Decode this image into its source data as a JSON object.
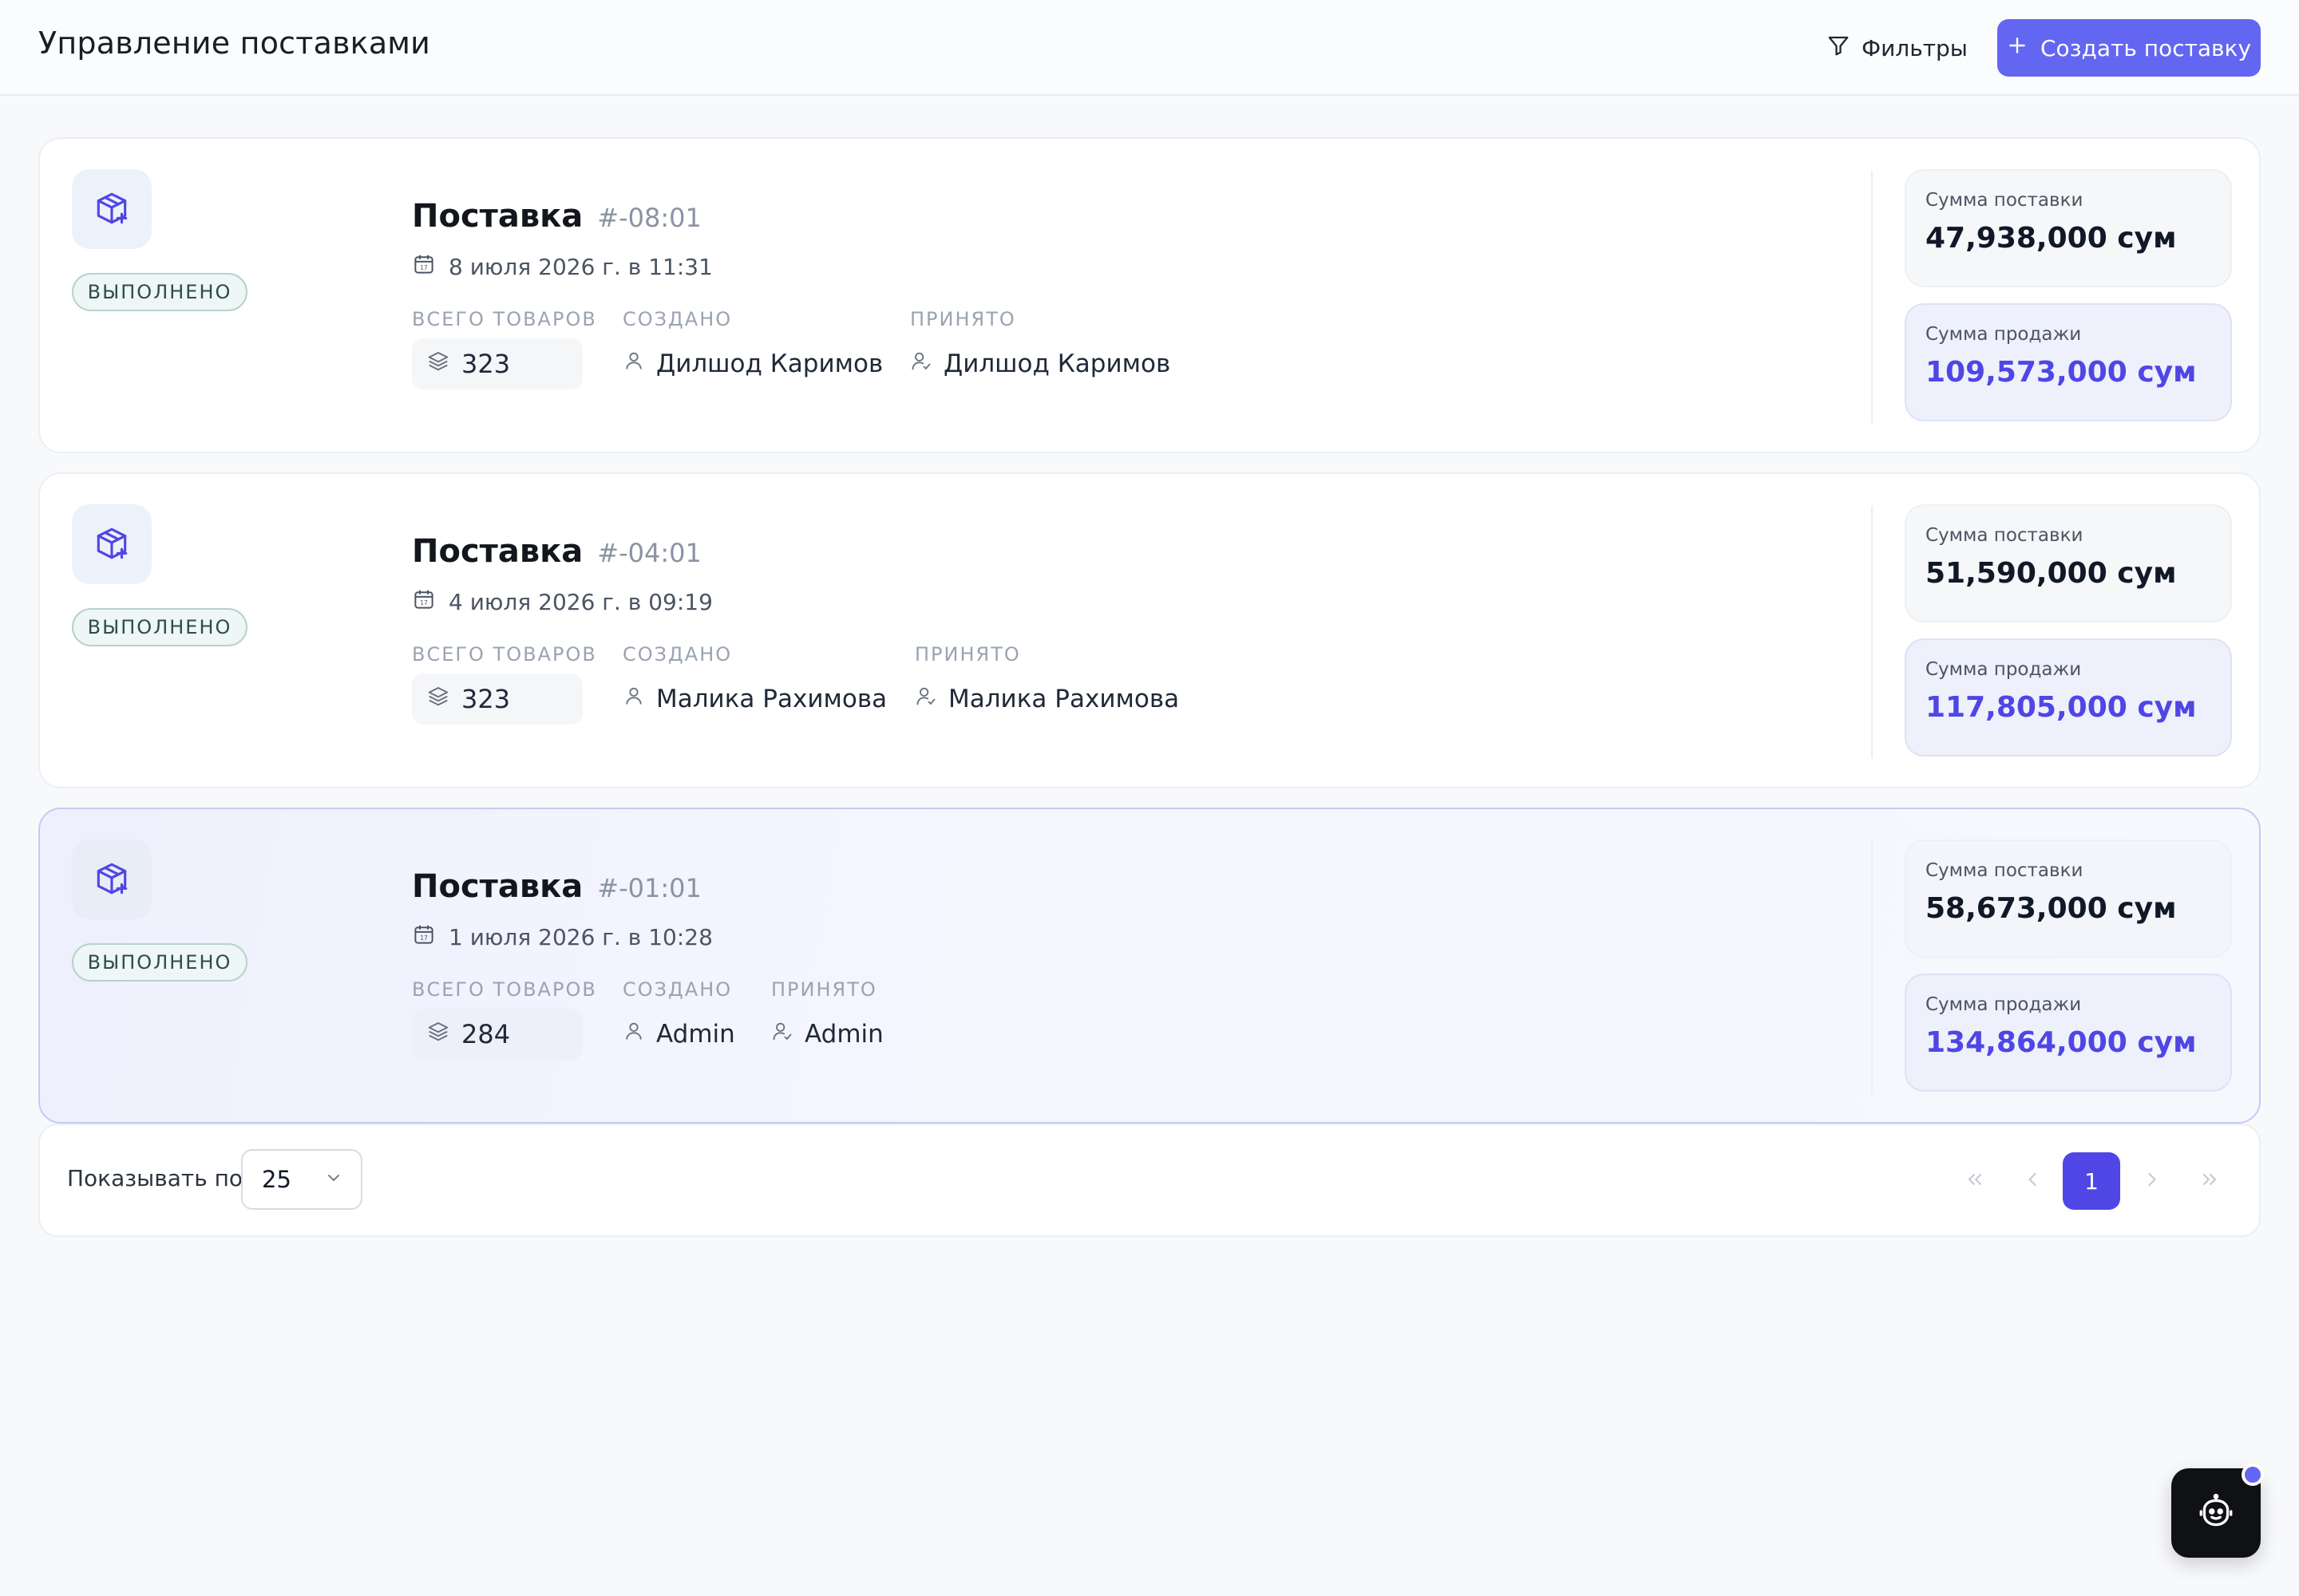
{
  "header": {
    "title": "Управление поставками",
    "filters_label": "Фильтры",
    "create_label": "Создать поставку",
    "filter_icon": "filter-icon",
    "plus_icon": "plus-icon"
  },
  "meta_labels": {
    "total_items": "ВСЕГО ТОВАРОВ",
    "created": "СОЗДАНО",
    "accepted": "ПРИНЯТО",
    "cost_sum": "Сумма поставки",
    "sale_sum": "Сумма продажи"
  },
  "shipments": [
    {
      "title": "Поставка",
      "number": "#-08:01",
      "date": "8 июля 2026 г. в 11:31",
      "status": "ВЫПОЛНЕНО",
      "total_items": "323",
      "created_by": "Дилшод Каримов",
      "accepted_by": "Дилшод Каримов",
      "cost_sum": "47,938,000 сум",
      "sale_sum": "109,573,000 сум"
    },
    {
      "title": "Поставка",
      "number": "#-04:01",
      "date": "4 июля 2026 г. в 09:19",
      "status": "ВЫПОЛНЕНО",
      "total_items": "323",
      "created_by": "Малика Рахимова",
      "accepted_by": "Малика Рахимова",
      "cost_sum": "51,590,000 сум",
      "sale_sum": "117,805,000 сум"
    },
    {
      "title": "Поставка",
      "number": "#-01:01",
      "date": "1 июля 2026 г. в 10:28",
      "status": "ВЫПОЛНЕНО",
      "total_items": "284",
      "created_by": "Admin",
      "accepted_by": "Admin",
      "cost_sum": "58,673,000 сум",
      "sale_sum": "134,864,000 сум"
    }
  ],
  "pagination": {
    "per_page_label": "Показывать по",
    "per_page_value": "25",
    "current_page": "1"
  },
  "colors": {
    "accent": "#6366f1",
    "accent_dark": "#4f46e5",
    "status_bg": "#eef6f6",
    "status_border": "#b6d2d0"
  }
}
